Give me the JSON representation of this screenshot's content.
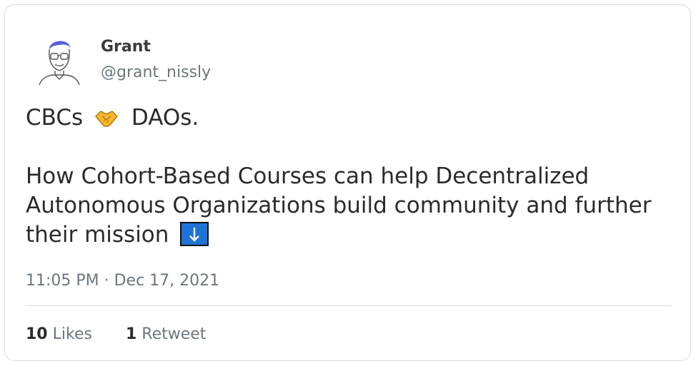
{
  "author": {
    "name": "Grant",
    "handle": "@grant_nissly",
    "avatar_icon": "avatar-illustration-icon"
  },
  "tweet": {
    "line1_start": "CBCs",
    "line1_emoji": "handshake-emoji",
    "line1_end": "DAOs.",
    "line2": "How Cohort-Based Courses can help Decentralized Autonomous Organizations build community and further their mission",
    "line2_emoji": "down-arrow-emoji"
  },
  "timestamp": "11:05 PM · Dec 17, 2021",
  "stats": {
    "likes_count": "10",
    "likes_label": "Likes",
    "retweets_count": "1",
    "retweets_label": "Retweet"
  },
  "colors": {
    "accent": "#5b5fd6",
    "text": "#2b2b2b",
    "muted": "#6e767d",
    "border": "#d6d9dc"
  }
}
